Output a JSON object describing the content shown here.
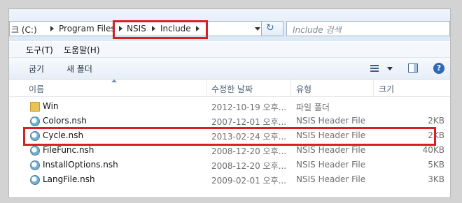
{
  "address": {
    "crumbs": [
      "크 (C:)",
      "Program Files",
      "NSIS",
      "Include"
    ],
    "search_placeholder": "Include 검색"
  },
  "menu": [
    "도구(T)",
    "도움말(H)"
  ],
  "toolbar": {
    "share_label": "굽기",
    "new_folder_label": "새 폴더",
    "help_glyph": "?"
  },
  "columns": {
    "name": "이름",
    "date": "수정한 날짜",
    "type": "유형",
    "size": "크기"
  },
  "files": [
    {
      "name": "Win",
      "date": "2012-10-19 오후...",
      "type": "파일 폴더",
      "size": "",
      "icon": "folder-icon"
    },
    {
      "name": "Colors.nsh",
      "date": "2007-12-01 오후...",
      "type": "NSIS Header File",
      "size": "2KB",
      "icon": "nsh-file-icon"
    },
    {
      "name": "Cycle.nsh",
      "date": "2013-02-24 오후...",
      "type": "NSIS Header File",
      "size": "2KB",
      "icon": "nsh-file-icon"
    },
    {
      "name": "FileFunc.nsh",
      "date": "2008-12-20 오후...",
      "type": "NSIS Header File",
      "size": "40KB",
      "icon": "nsh-file-icon"
    },
    {
      "name": "InstallOptions.nsh",
      "date": "2008-12-20 오후...",
      "type": "NSIS Header File",
      "size": "5KB",
      "icon": "nsh-file-icon"
    },
    {
      "name": "LangFile.nsh",
      "date": "2009-02-01 오후...",
      "type": "NSIS Header File",
      "size": "3KB",
      "icon": "nsh-file-icon"
    }
  ],
  "colors": {
    "highlight": "#d71f26"
  }
}
